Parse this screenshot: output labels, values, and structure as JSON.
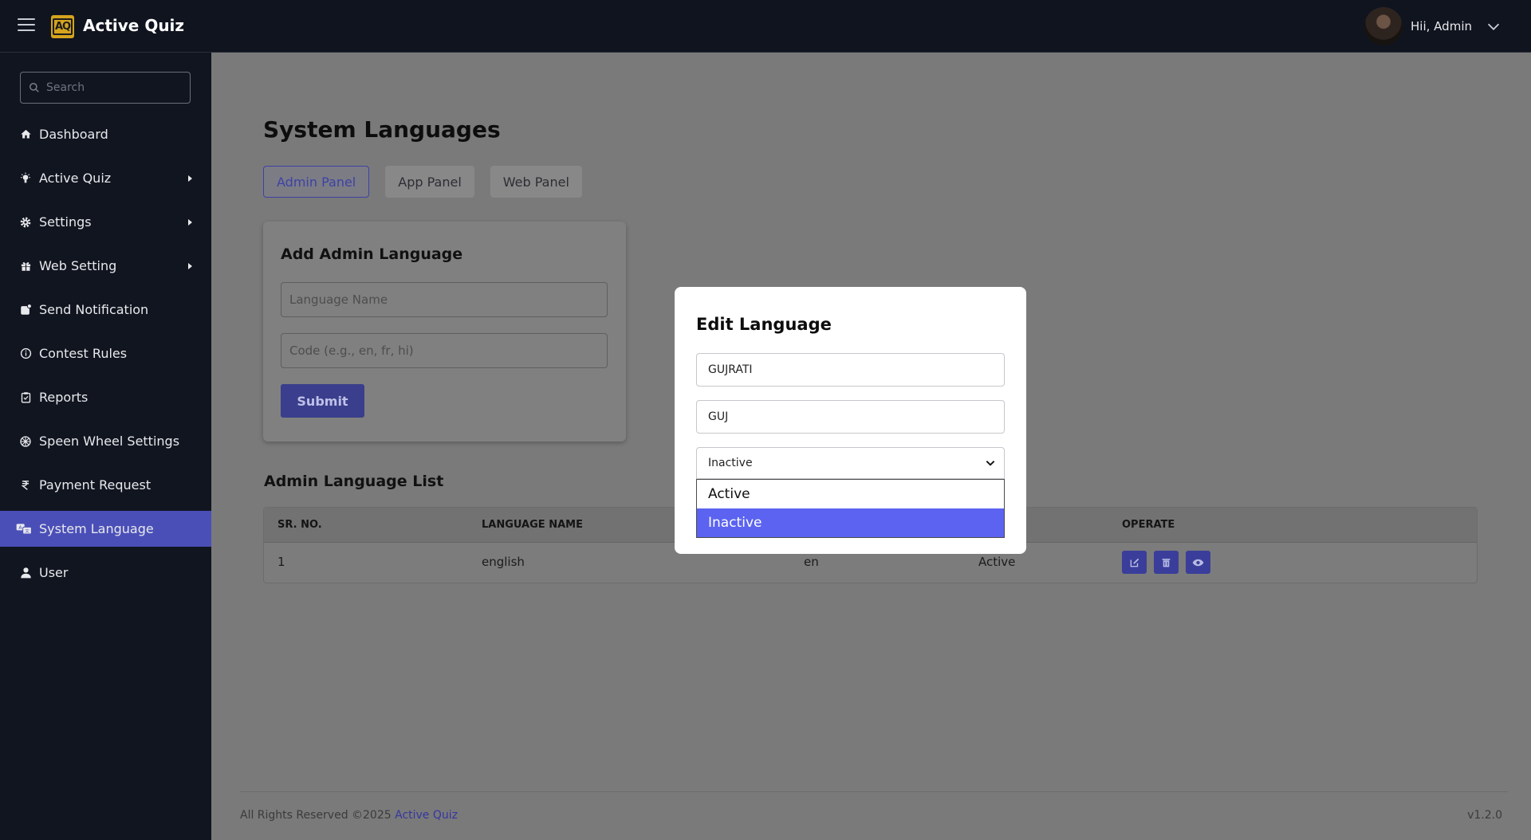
{
  "app": {
    "brand_logo_text": "AQ",
    "brand_name": "Active Quiz",
    "greeting": "Hii, Admin"
  },
  "sidebar": {
    "search_placeholder": "Search",
    "items": [
      {
        "label": "Dashboard",
        "icon": "home-icon",
        "has_submenu": false
      },
      {
        "label": "Active Quiz",
        "icon": "lightbulb-icon",
        "has_submenu": true
      },
      {
        "label": "Settings",
        "icon": "gear-icon",
        "has_submenu": true
      },
      {
        "label": "Web Setting",
        "icon": "gift-icon",
        "has_submenu": true
      },
      {
        "label": "Send Notification",
        "icon": "notification-icon",
        "has_submenu": false
      },
      {
        "label": "Contest Rules",
        "icon": "info-icon",
        "has_submenu": false
      },
      {
        "label": "Reports",
        "icon": "clipboard-icon",
        "has_submenu": false
      },
      {
        "label": "Speen Wheel Settings",
        "icon": "wheel-icon",
        "has_submenu": false
      },
      {
        "label": "Payment Request",
        "icon": "rupee-icon",
        "has_submenu": false
      },
      {
        "label": "System Language",
        "icon": "language-icon",
        "has_submenu": false,
        "active": true
      },
      {
        "label": "User",
        "icon": "user-icon",
        "has_submenu": false
      }
    ]
  },
  "main": {
    "title": "System Languages",
    "tabs": [
      {
        "label": "Admin Panel",
        "active": true
      },
      {
        "label": "App Panel",
        "active": false
      },
      {
        "label": "Web Panel",
        "active": false
      }
    ],
    "add_form": {
      "title": "Add Admin Language",
      "name_placeholder": "Language Name",
      "code_placeholder": "Code (e.g., en, fr, hi)",
      "submit_label": "Submit"
    },
    "list": {
      "title": "Admin Language List",
      "columns": [
        "SR. NO.",
        "LANGUAGE NAME",
        "OPERATE"
      ],
      "rows": [
        {
          "sr": "1",
          "name": "english",
          "code": "en",
          "status": "Active"
        }
      ]
    }
  },
  "footer": {
    "rights": "All Rights Reserved ©2025",
    "link": "Active Quiz",
    "version": "v1.2.0"
  },
  "modal": {
    "title": "Edit Language",
    "name_value": "GUJRATI",
    "code_value": "GUJ",
    "status_selected": "Inactive",
    "status_options": [
      "Active",
      "Inactive"
    ]
  },
  "colors": {
    "accent": "#5b63f0",
    "sidebar_active": "#4a4fb8",
    "topbar": "#10141f"
  }
}
